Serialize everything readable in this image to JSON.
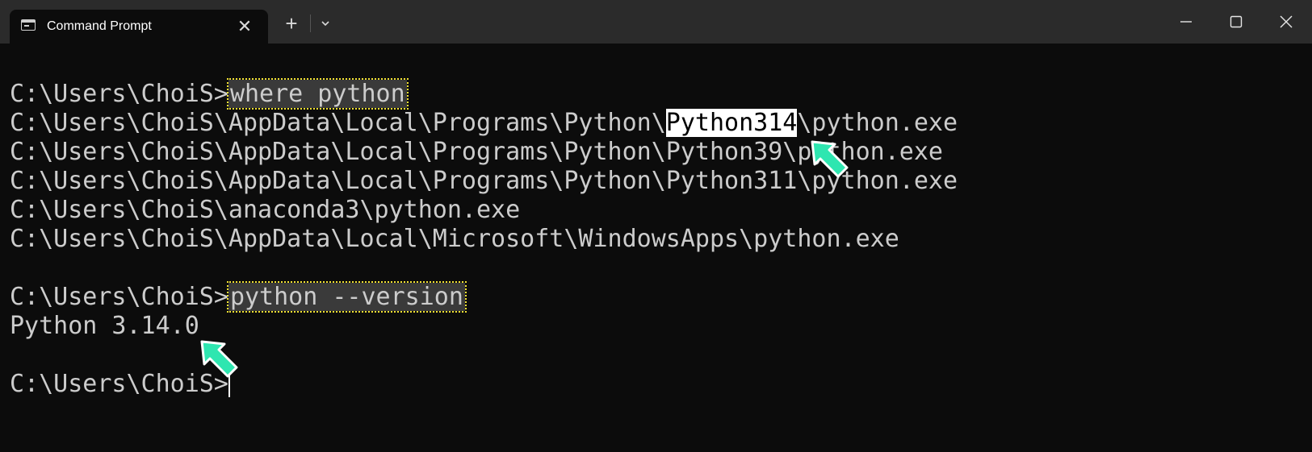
{
  "window": {
    "tab_title": "Command Prompt",
    "icons": {
      "tab": "terminal-icon",
      "tab_close": "close-icon",
      "new_tab": "plus-icon",
      "dropdown": "chevron-down-icon",
      "minimize": "minimize-icon",
      "maximize": "maximize-icon",
      "close": "close-icon"
    },
    "tab_close_glyph": "✕",
    "new_tab_glyph": "+"
  },
  "terminal": {
    "prompt": "C:\\Users\\ChoiS>",
    "command1": "where python",
    "results": [
      {
        "prefix": "C:\\Users\\ChoiS\\AppData\\Local\\Programs\\Python\\",
        "highlight": "Python314",
        "suffix": "\\python.exe"
      },
      {
        "text": "C:\\Users\\ChoiS\\AppData\\Local\\Programs\\Python\\Python39\\python.exe"
      },
      {
        "text": "C:\\Users\\ChoiS\\AppData\\Local\\Programs\\Python\\Python311\\python.exe"
      },
      {
        "text": "C:\\Users\\ChoiS\\anaconda3\\python.exe"
      },
      {
        "text": "C:\\Users\\ChoiS\\AppData\\Local\\Microsoft\\WindowsApps\\python.exe"
      }
    ],
    "command2": "python --version",
    "version_output": "Python 3.14.0"
  },
  "colors": {
    "background": "#0c0c0c",
    "titlebar": "#2b2b2b",
    "text": "#cccccc",
    "command_box_border": "#f2e233",
    "annotation_arrow": "#2ee6b0"
  }
}
